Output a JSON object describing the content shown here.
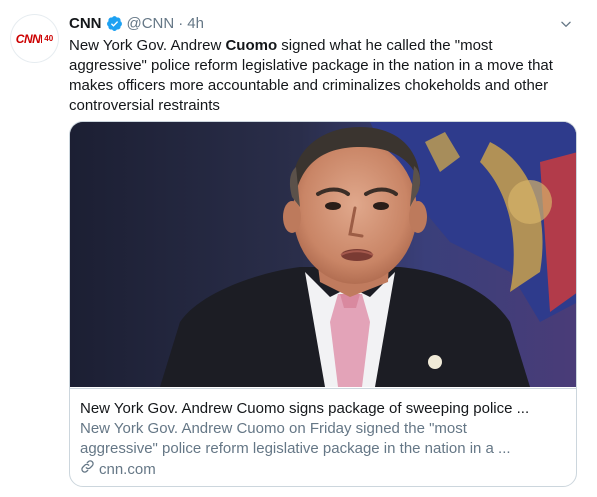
{
  "tweet": {
    "author_name": "CNN",
    "author_handle": "@CNN",
    "separator": "·",
    "time": "4h",
    "avatar_text": "CNN",
    "avatar_badge": "40",
    "text_before": "New York Gov. Andrew ",
    "text_bold": "Cuomo",
    "text_after": " signed what he called the \"most aggressive\" police reform legislative package in the nation in a move that makes officers more accountable and criminalizes chokeholds and other controversial restraints"
  },
  "card": {
    "title": "New York Gov. Andrew Cuomo signs package of sweeping police ...",
    "description_line1": "New York Gov. Andrew Cuomo on Friday signed the \"most",
    "description_line2": "aggressive\" police reform legislative package in the nation in a ...",
    "domain": "cnn.com"
  },
  "icons": {
    "verified": "verified-badge-icon",
    "caret": "chevron-down-icon",
    "link": "link-icon"
  },
  "colors": {
    "verified": "#1da1f2",
    "brand_red": "#cc0000",
    "secondary_text": "#657786",
    "border": "#ccd6dd"
  }
}
